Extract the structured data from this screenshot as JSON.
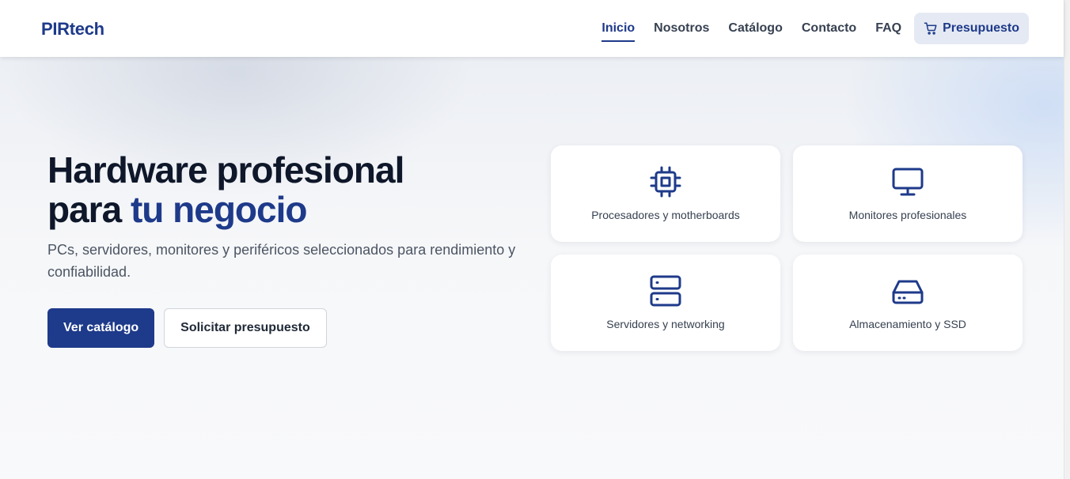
{
  "brand": {
    "name": "PIRtech",
    "accent": "#1e3a8a"
  },
  "nav": {
    "items": [
      "Inicio",
      "Nosotros",
      "Catálogo",
      "Contacto",
      "FAQ"
    ],
    "active": "Inicio",
    "quote_label": "Presupuesto",
    "quote_icon": "cart-icon"
  },
  "hero": {
    "title_line1": "Hardware profesional",
    "title_line2_plain": "para ",
    "title_line2_accent": "tu negocio",
    "lead": "PCs, servidores, monitores y periféricos seleccionados para rendimiento y confiabilidad.",
    "primary_cta": "Ver catálogo",
    "secondary_cta": "Solicitar presupuesto"
  },
  "categories": [
    {
      "label": "Procesadores y motherboards",
      "icon": "cpu-icon"
    },
    {
      "label": "Monitores profesionales",
      "icon": "monitor-icon"
    },
    {
      "label": "Servidores y networking",
      "icon": "server-icon"
    },
    {
      "label": "Almacenamiento y SSD",
      "icon": "hard-drive-icon"
    }
  ]
}
